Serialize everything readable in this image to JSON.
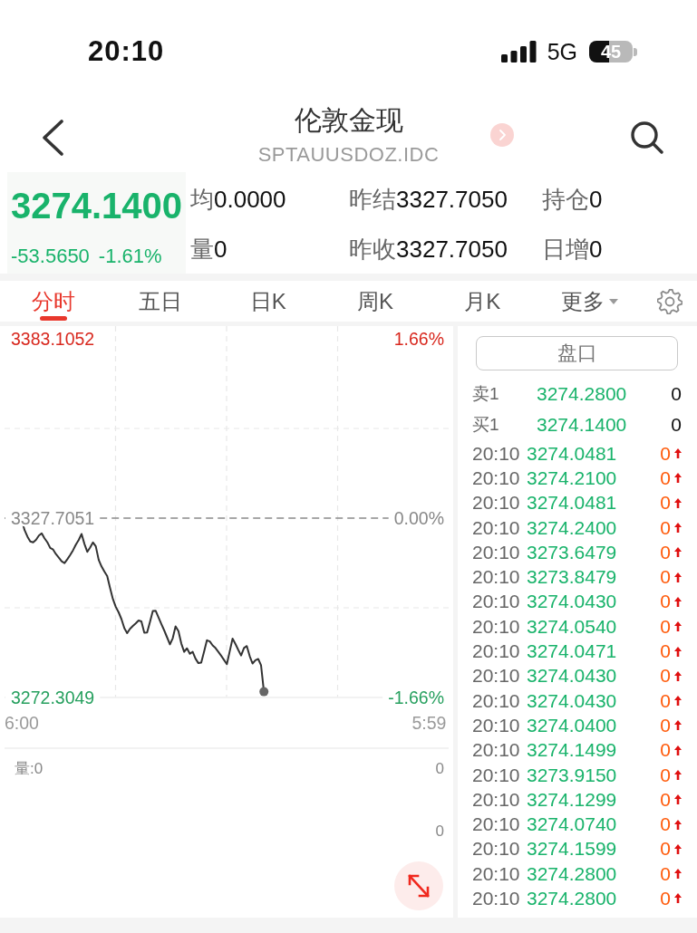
{
  "status_bar": {
    "time": "20:10",
    "network": "5G",
    "battery": "45"
  },
  "header": {
    "title": "伦敦金现",
    "subtitle": "SPTAUUSDOZ.IDC"
  },
  "quote": {
    "price": "3274.1400",
    "change": "-53.5650",
    "change_percent": "-1.61%",
    "rising": false,
    "fields": [
      {
        "label": "均",
        "value": "0.0000"
      },
      {
        "label": "昨结",
        "value": "3327.7050"
      },
      {
        "label": "持仓",
        "value": "0"
      },
      {
        "label": "量",
        "value": "0"
      },
      {
        "label": "昨收",
        "value": "3327.7050"
      },
      {
        "label": "日增",
        "value": "0"
      }
    ]
  },
  "tabs": [
    {
      "label": "分时",
      "kind": "tab",
      "selected": true
    },
    {
      "label": "五日",
      "kind": "tab",
      "selected": false
    },
    {
      "label": "日K",
      "kind": "tab",
      "selected": false
    },
    {
      "label": "周K",
      "kind": "tab",
      "selected": false
    },
    {
      "label": "月K",
      "kind": "tab",
      "selected": false
    },
    {
      "label": "更多",
      "kind": "dropdown",
      "selected": false
    }
  ],
  "chart": {
    "chart_data": {
      "type": "line",
      "categories": [
        "6:00",
        null,
        null,
        null,
        null,
        null,
        null,
        null,
        null,
        null,
        null,
        null,
        null,
        null,
        null,
        null,
        null,
        null,
        null,
        null,
        null,
        null,
        null,
        null,
        null,
        null,
        null,
        null,
        null,
        null,
        null,
        null,
        null,
        null,
        null,
        null,
        null,
        null,
        null,
        null,
        null,
        null,
        null,
        null,
        null,
        null,
        null,
        null,
        null,
        null,
        null,
        null,
        null,
        null,
        null,
        null,
        null,
        null,
        null,
        null,
        null,
        null,
        null,
        null,
        null,
        null,
        null,
        null,
        null,
        null,
        null,
        null,
        null,
        null,
        null,
        null,
        null,
        null,
        null,
        null,
        null,
        null,
        null,
        null,
        null,
        null,
        null,
        null,
        null,
        null,
        null,
        null,
        null,
        null,
        null,
        null,
        null,
        null,
        null,
        null,
        null,
        null,
        null,
        null,
        null,
        null,
        null,
        null,
        null,
        null,
        null,
        null,
        null,
        null,
        null,
        null,
        null,
        null,
        null,
        null,
        null,
        null,
        null,
        null,
        null,
        null,
        null,
        null,
        null,
        null,
        null,
        null,
        null,
        null,
        null,
        null,
        null,
        null,
        null,
        null,
        null,
        null,
        null,
        "5:59"
      ],
      "series": [
        {
          "color": "#333333",
          "values": [
            3327.2,
            3324.0,
            3322.0,
            3320.5,
            3320.2,
            3321.0,
            3322.3,
            3323.0,
            3321.5,
            3320.2,
            3318.5,
            3318.0,
            3316.6,
            3315.5,
            3314.4,
            3313.8,
            3315.0,
            3316.3,
            3317.8,
            3319.5,
            3321.0,
            3322.8,
            3319.7,
            3317.3,
            3318.6,
            3320.2,
            3319.0,
            3314.8,
            3312.8,
            3311.2,
            3309.8,
            3306.2,
            3302.7,
            3300.3,
            3298.6,
            3296.5,
            3293.7,
            3292.2,
            3293.5,
            3294.4,
            3295.2,
            3296.1,
            3295.8,
            3292.3,
            3292.4,
            3295.7,
            3299.0,
            3299.1,
            3297.0,
            3295.0,
            3293.0,
            3290.9,
            3288.7,
            3290.6,
            3294.3,
            3292.8,
            3289.0,
            3286.4,
            3287.5,
            3285.8,
            3286.4,
            3284.3,
            3282.9,
            3283.1,
            3286.5,
            3290.0,
            3289.6,
            3288.4,
            3287.6,
            3286.4,
            3285.2,
            3283.9,
            3282.6,
            3286.6,
            3290.5,
            3288.8,
            3287.0,
            3285.3,
            3287.6,
            3288.2,
            3285.1,
            3282.8,
            3283.8,
            3284.2,
            3282.3,
            3274.1,
            null,
            null,
            null,
            null,
            null,
            null,
            null,
            null,
            null,
            null,
            null,
            null,
            null,
            null,
            null,
            null,
            null,
            null,
            null,
            null,
            null,
            null,
            null,
            null,
            null,
            null,
            null,
            null,
            null,
            null,
            null,
            null,
            null,
            null,
            null,
            null,
            null,
            null,
            null,
            null,
            null,
            null,
            null,
            null,
            null,
            null,
            null,
            null,
            null,
            null,
            null,
            null,
            null,
            null,
            null,
            null,
            null,
            null
          ]
        }
      ],
      "ylim": [
        3272.3049,
        3383.1052
      ],
      "yticks": [
        {
          "value": 3383.1052,
          "label": "3383.1052"
        },
        {
          "value": 3327.7051,
          "label": "3327.7051"
        },
        {
          "value": 3272.3049,
          "label": "3272.3049"
        }
      ]
    },
    "right_labels": [
      "1.66%",
      "0.00%",
      "-1.66%"
    ]
  },
  "volume": {
    "label": "量:0",
    "axis_labels": [
      "0",
      "0"
    ]
  },
  "order_book": {
    "button": "盘口",
    "levels": [
      {
        "side": "卖1",
        "price": "3274.2800",
        "volume": "0"
      },
      {
        "side": "买1",
        "price": "3274.1400",
        "volume": "0"
      }
    ]
  },
  "trades": [
    {
      "time": "20:10",
      "price": "3274.0481",
      "volume": "0"
    },
    {
      "time": "20:10",
      "price": "3274.2100",
      "volume": "0"
    },
    {
      "time": "20:10",
      "price": "3274.0481",
      "volume": "0"
    },
    {
      "time": "20:10",
      "price": "3274.2400",
      "volume": "0"
    },
    {
      "time": "20:10",
      "price": "3273.6479",
      "volume": "0"
    },
    {
      "time": "20:10",
      "price": "3273.8479",
      "volume": "0"
    },
    {
      "time": "20:10",
      "price": "3274.0430",
      "volume": "0"
    },
    {
      "time": "20:10",
      "price": "3274.0540",
      "volume": "0"
    },
    {
      "time": "20:10",
      "price": "3274.0471",
      "volume": "0"
    },
    {
      "time": "20:10",
      "price": "3274.0430",
      "volume": "0"
    },
    {
      "time": "20:10",
      "price": "3274.0430",
      "volume": "0"
    },
    {
      "time": "20:10",
      "price": "3274.0400",
      "volume": "0"
    },
    {
      "time": "20:10",
      "price": "3274.1499",
      "volume": "0"
    },
    {
      "time": "20:10",
      "price": "3273.9150",
      "volume": "0"
    },
    {
      "time": "20:10",
      "price": "3274.1299",
      "volume": "0"
    },
    {
      "time": "20:10",
      "price": "3274.0740",
      "volume": "0"
    },
    {
      "time": "20:10",
      "price": "3274.1599",
      "volume": "0"
    },
    {
      "time": "20:10",
      "price": "3274.2800",
      "volume": "0"
    },
    {
      "time": "20:10",
      "price": "3274.2800",
      "volume": "0"
    }
  ]
}
